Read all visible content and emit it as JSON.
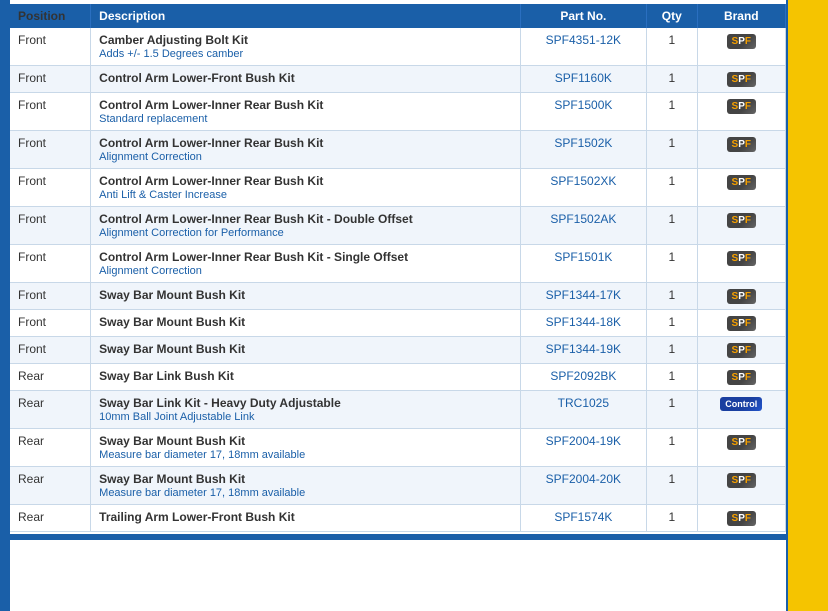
{
  "table": {
    "columns": [
      "Position",
      "Description",
      "Part No.",
      "Qty",
      "Brand"
    ],
    "rows": [
      {
        "position": "Front",
        "name": "Camber Adjusting Bolt Kit",
        "note": "Adds +/- 1.5 Degrees camber",
        "partno": "SPF4351-12K",
        "qty": "1",
        "brand": "SPF"
      },
      {
        "position": "Front",
        "name": "Control Arm Lower-Front Bush Kit",
        "note": "",
        "partno": "SPF1160K",
        "qty": "1",
        "brand": "SPF"
      },
      {
        "position": "Front",
        "name": "Control Arm Lower-Inner Rear Bush Kit",
        "note": "Standard replacement",
        "partno": "SPF1500K",
        "qty": "1",
        "brand": "SPF"
      },
      {
        "position": "Front",
        "name": "Control Arm Lower-Inner Rear Bush Kit",
        "note": "Alignment Correction",
        "partno": "SPF1502K",
        "qty": "1",
        "brand": "SPF"
      },
      {
        "position": "Front",
        "name": "Control Arm Lower-Inner Rear Bush Kit",
        "note": "Anti Lift & Caster Increase",
        "partno": "SPF1502XK",
        "qty": "1",
        "brand": "SPF"
      },
      {
        "position": "Front",
        "name": "Control Arm Lower-Inner Rear Bush Kit - Double Offset",
        "note": "Alignment Correction for Performance",
        "partno": "SPF1502AK",
        "qty": "1",
        "brand": "SPF"
      },
      {
        "position": "Front",
        "name": "Control Arm Lower-Inner Rear Bush Kit - Single Offset",
        "note": "Alignment Correction",
        "partno": "SPF1501K",
        "qty": "1",
        "brand": "SPF"
      },
      {
        "position": "Front",
        "name": "Sway Bar Mount Bush Kit",
        "note": "",
        "partno": "SPF1344-17K",
        "qty": "1",
        "brand": "SPF"
      },
      {
        "position": "Front",
        "name": "Sway Bar Mount Bush Kit",
        "note": "",
        "partno": "SPF1344-18K",
        "qty": "1",
        "brand": "SPF"
      },
      {
        "position": "Front",
        "name": "Sway Bar Mount Bush Kit",
        "note": "",
        "partno": "SPF1344-19K",
        "qty": "1",
        "brand": "SPF"
      },
      {
        "position": "Rear",
        "name": "Sway Bar Link Bush Kit",
        "note": "",
        "partno": "SPF2092BK",
        "qty": "1",
        "brand": "SPF"
      },
      {
        "position": "Rear",
        "name": "Sway Bar Link Kit - Heavy Duty Adjustable",
        "note": "10mm Ball Joint Adjustable Link",
        "partno": "TRC1025",
        "qty": "1",
        "brand": "CTRL"
      },
      {
        "position": "Rear",
        "name": "Sway Bar Mount Bush Kit",
        "note": "Measure bar diameter 17, 18mm available",
        "partno": "SPF2004-19K",
        "qty": "1",
        "brand": "SPF"
      },
      {
        "position": "Rear",
        "name": "Sway Bar Mount Bush Kit",
        "note": "Measure bar diameter 17, 18mm available",
        "partno": "SPF2004-20K",
        "qty": "1",
        "brand": "SPF"
      },
      {
        "position": "Rear",
        "name": "Trailing Arm Lower-Front Bush Kit",
        "note": "",
        "partno": "SPF1574K",
        "qty": "1",
        "brand": "SPF"
      }
    ]
  }
}
